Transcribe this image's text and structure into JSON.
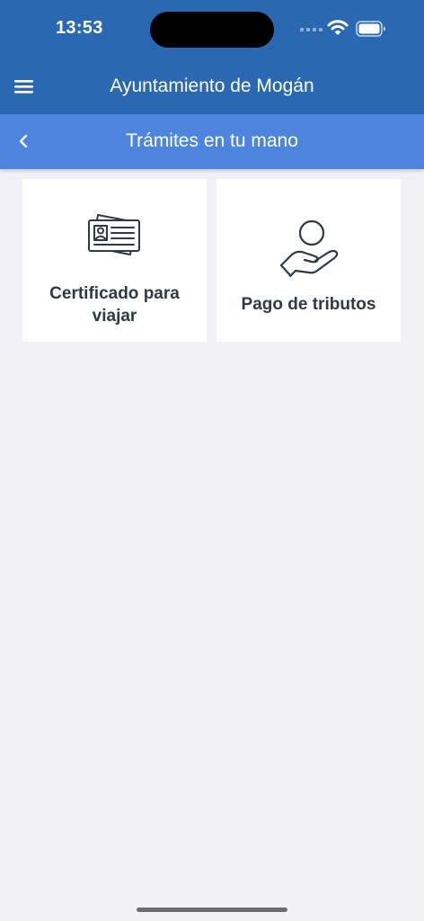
{
  "status_bar": {
    "time": "13:53"
  },
  "app_bar": {
    "title": "Ayuntamiento de Mogán",
    "menu_icon": "hamburger-menu-icon"
  },
  "sub_bar": {
    "title": "Trámites en tu mano",
    "back_icon": "chevron-left-icon"
  },
  "cards": [
    {
      "label": "Certificado para viajar",
      "icon": "id-card-icon"
    },
    {
      "label": "Pago de tributos",
      "icon": "hand-coin-icon"
    }
  ],
  "colors": {
    "app_bar": "#2a68b2",
    "sub_bar": "#4d84de",
    "background": "#f2f1f6",
    "card": "#ffffff",
    "card_text": "#2d3a46",
    "icon_stroke": "#2d3a46"
  }
}
